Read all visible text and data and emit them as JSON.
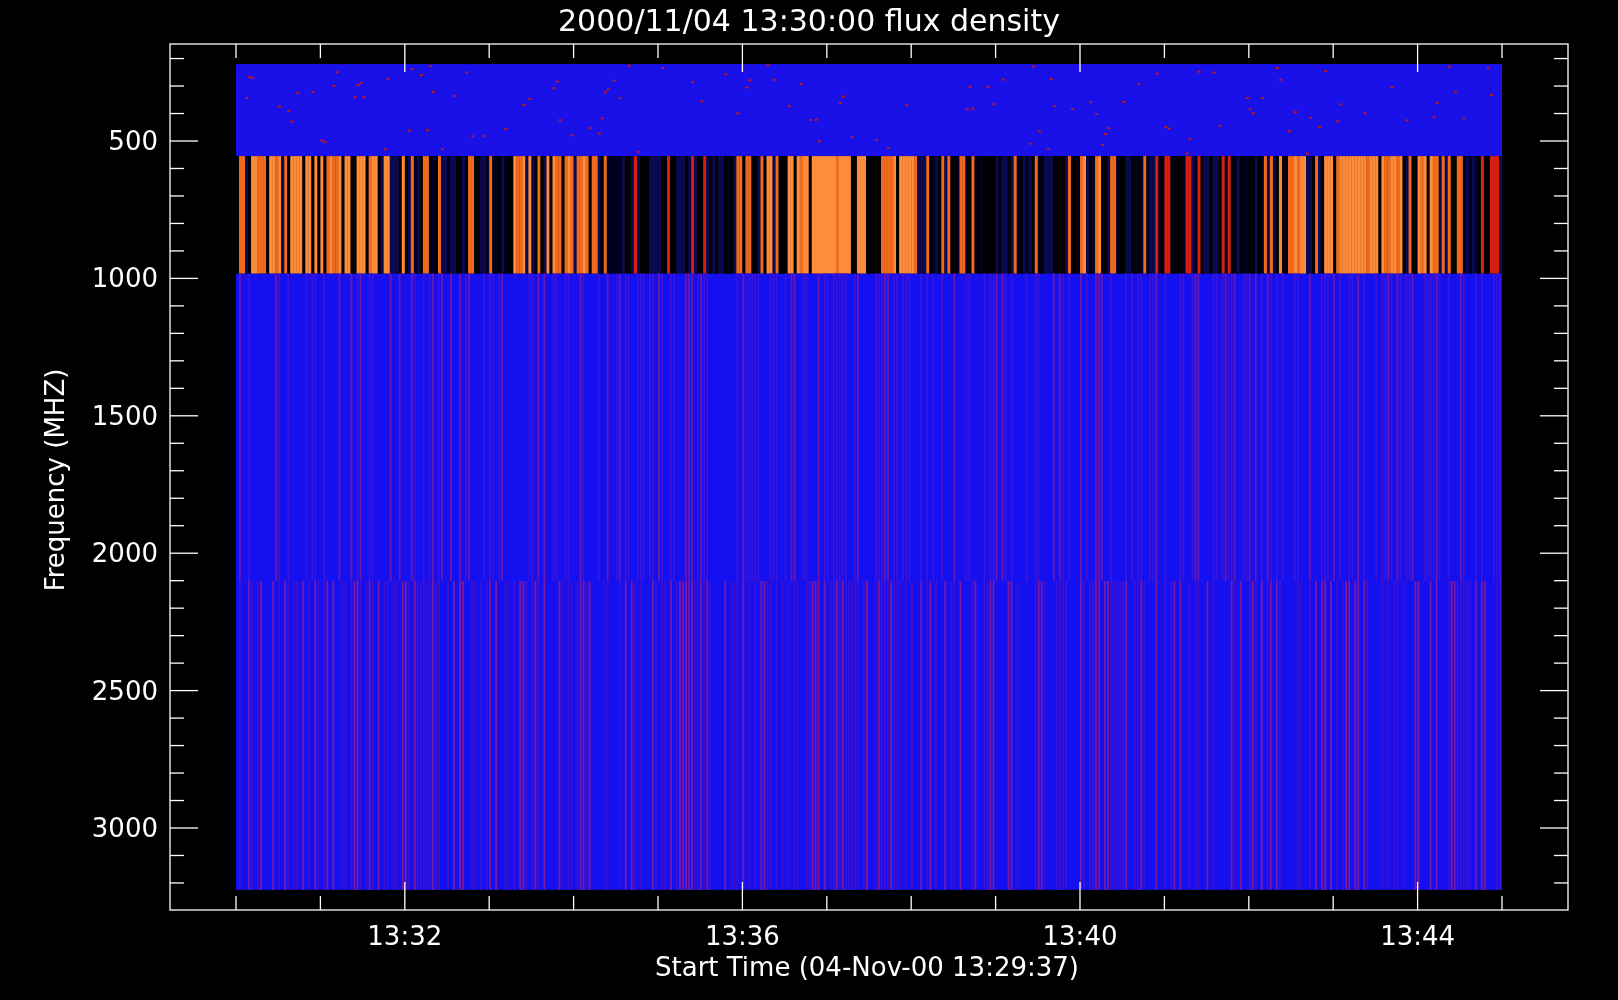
{
  "title": "2000/11/04 13:30:00 flux density",
  "plot": {
    "ylabel": "Frequency (MHZ)",
    "xlabel": "Start Time (04-Nov-00 13:29:37)",
    "yticks": [
      "500",
      "1000",
      "1500",
      "2000",
      "2500",
      "3000"
    ],
    "xticks": [
      "13:32",
      "13:36",
      "13:40",
      "13:44"
    ]
  }
}
